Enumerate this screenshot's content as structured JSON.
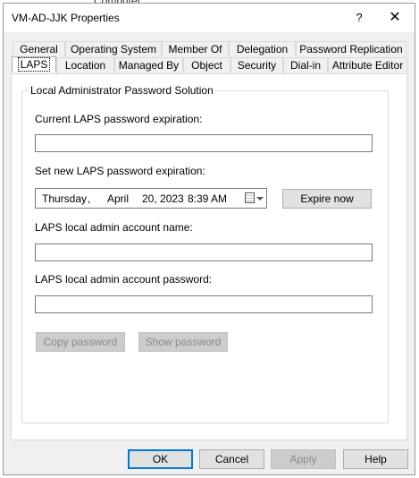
{
  "background": {
    "partial_text": "Computer"
  },
  "window": {
    "title": "VM-AD-JJK Properties",
    "help_glyph": "?",
    "close_glyph": "✕"
  },
  "tabs": {
    "row1": [
      "General",
      "Operating System",
      "Member Of",
      "Delegation",
      "Password Replication"
    ],
    "row2": [
      "LAPS",
      "Location",
      "Managed By",
      "Object",
      "Security",
      "Dial-in",
      "Attribute Editor"
    ],
    "active": "LAPS"
  },
  "laps": {
    "group_title": "Local Administrator Password Solution",
    "current_expiration_label": "Current LAPS password expiration:",
    "current_expiration_value": "",
    "set_new_expiration_label": "Set new LAPS password expiration:",
    "date": {
      "weekday": "Thursday",
      "sep": ",",
      "month": "April",
      "day": "20, 2023",
      "time": "8:39 AM"
    },
    "expire_now_label": "Expire now",
    "account_name_label": "LAPS local admin account name:",
    "account_name_value": "",
    "account_password_label": "LAPS local admin account password:",
    "account_password_value": "",
    "copy_password_label": "Copy password",
    "show_password_label": "Show password"
  },
  "footer": {
    "ok": "OK",
    "cancel": "Cancel",
    "apply": "Apply",
    "help": "Help"
  },
  "colors": {
    "dialog_bg": "#f0f0f0",
    "panel_bg": "#ffffff",
    "focus_border": "#0078d7",
    "disabled_text": "#8a8a8a"
  }
}
